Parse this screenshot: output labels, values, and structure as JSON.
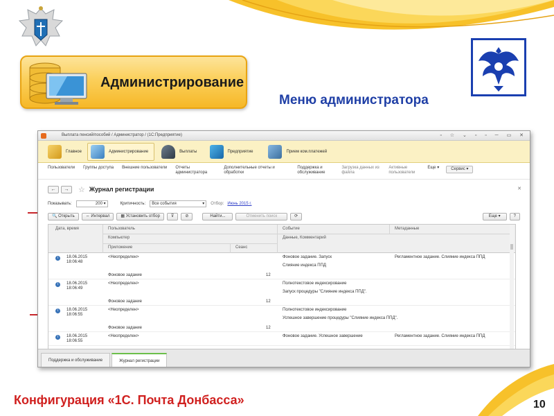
{
  "slide": {
    "badge_label": "Администрирование",
    "menu_title": "Меню администратора",
    "footer_text": "Конфигурация «1С. Почта Донбасса»",
    "page_number": "10"
  },
  "window": {
    "title": "Выплата пенсий/пособий / Администратор /  (1С:Предприятие)",
    "sections": [
      {
        "label": "Главное"
      },
      {
        "label": "Администрирование"
      },
      {
        "label": "Выплаты"
      },
      {
        "label": "Предприятие"
      },
      {
        "label": "Прием ком.платежей"
      }
    ],
    "commands": {
      "users": "Пользователи",
      "access_groups": "Группы доступа",
      "external_users": "Внешние пользователи",
      "admin_reports": "Отчеты администратора",
      "ext_reports": "Дополнительные отчеты и обработки",
      "support": "Поддержка и обслуживание",
      "load_data": "Загрузка данных из файла",
      "active_users": "Активные пользователи",
      "more": "Еще ▾",
      "service": "Сервис ▾"
    },
    "form": {
      "title": "Журнал регистрации",
      "show_label": "Показывать:",
      "show_value": "200",
      "criticality_label": "Критичность:",
      "criticality_value": "Все события",
      "filter_label": "Отбор:",
      "filter_link": "Июнь 2015 г.",
      "open_btn": "Открыть",
      "interval_btn": "Интервал",
      "set_filter_btn": "Установить отбор",
      "find_btn": "Найти...",
      "cancel_search_btn": "Отменить поиск",
      "more_btn": "Еще ▾",
      "help_btn": "?"
    },
    "columns": {
      "date": "Дата, время",
      "user": "Пользователь",
      "computer": "Компьютер",
      "app": "Приложение",
      "session": "Сеанс",
      "event": "Событие",
      "data": "Данные, Комментарий",
      "metadata": "Метаданные"
    },
    "rows": [
      {
        "date": "18.06.2015",
        "time": "18:06:48",
        "user": "<Неопределен>",
        "app": "Фоновое задание",
        "session": "12",
        "event": "Фоновое задание. Запуск",
        "comment": "Слияние индекса ППД",
        "metadata": "Регламентное задание. Слияние индекса ППД"
      },
      {
        "date": "18.06.2015",
        "time": "18:06:49",
        "user": "<Неопределен>",
        "app": "Фоновое задание",
        "session": "12",
        "event": "Полнотекстовое индексирование",
        "comment": "Запуск процедуры \"Слияние индекса ППД\".",
        "metadata": ""
      },
      {
        "date": "18.06.2015",
        "time": "18:06:55",
        "user": "<Неопределен>",
        "app": "Фоновое задание",
        "session": "12",
        "event": "Полнотекстовое индексирование",
        "comment": "Успешное завершение процедуры \"Слияние индекса ППД\".",
        "metadata": ""
      },
      {
        "date": "18.06.2015",
        "time": "18:06:55",
        "user": "<Неопределен>",
        "app": "",
        "session": "",
        "event": "Фоновое задание. Успешное завершение",
        "comment": "",
        "metadata": "Регламентное задание. Слияние индекса ППД"
      }
    ],
    "footer_tabs": [
      {
        "label": "Поддержка и обслуживание"
      },
      {
        "label": "Журнал регистрации"
      }
    ]
  },
  "colors": {
    "accent_red": "#d0201f",
    "title_blue": "#1f3fa6",
    "badge_gold": "#fbcf5a",
    "section_bar": "#fbf1c4"
  },
  "icons": [
    "emblem-icon",
    "database-computer-icon",
    "post-eagle-icon",
    "star-icon",
    "info-icon"
  ]
}
